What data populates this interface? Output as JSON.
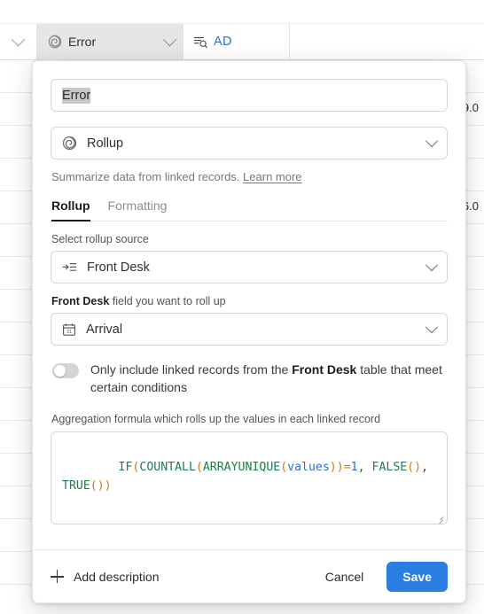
{
  "grid": {
    "header_cells": [
      {
        "icon": "chevron-down-icon",
        "label": ""
      },
      {
        "icon": "rollup-spiral-icon",
        "label": "Error"
      },
      {
        "icon": "lookup-search-icon",
        "label": "AD"
      }
    ],
    "visible_cell_values": [
      "9.0",
      "6.0"
    ]
  },
  "modal": {
    "name_field": {
      "value": "Error",
      "selected": true
    },
    "type_field": {
      "value": "Rollup",
      "icon": "rollup-spiral-icon"
    },
    "description": "Summarize data from linked records.",
    "learn_more": "Learn more",
    "tabs": [
      {
        "label": "Rollup",
        "active": true
      },
      {
        "label": "Formatting",
        "active": false
      }
    ],
    "rollup_source": {
      "label": "Select rollup source",
      "value": "Front Desk",
      "icon": "link-to-record-icon"
    },
    "rollup_field": {
      "label_bold": "Front Desk",
      "label_rest": " field you want to roll up",
      "value": "Arrival",
      "icon": "calendar-icon"
    },
    "conditions_toggle": {
      "enabled": false,
      "text_before": "Only include linked records from the ",
      "text_bold": "Front Desk",
      "text_after": " table that meet certain conditions"
    },
    "formula": {
      "label": "Aggregation formula which rolls up the values in each linked record",
      "value": "IF(COUNTALL(ARRAYUNIQUE(values))=1, FALSE(), TRUE())"
    },
    "footer": {
      "add_description": "Add description",
      "cancel": "Cancel",
      "save": "Save"
    }
  },
  "colors": {
    "accent": "#2a7de1",
    "tab_active": "#1c1c1c",
    "formula_function": "#1b7f4a",
    "formula_paren": "#d07b12",
    "formula_variable": "#2c6fd1",
    "ad_text": "#2f6fd0"
  }
}
